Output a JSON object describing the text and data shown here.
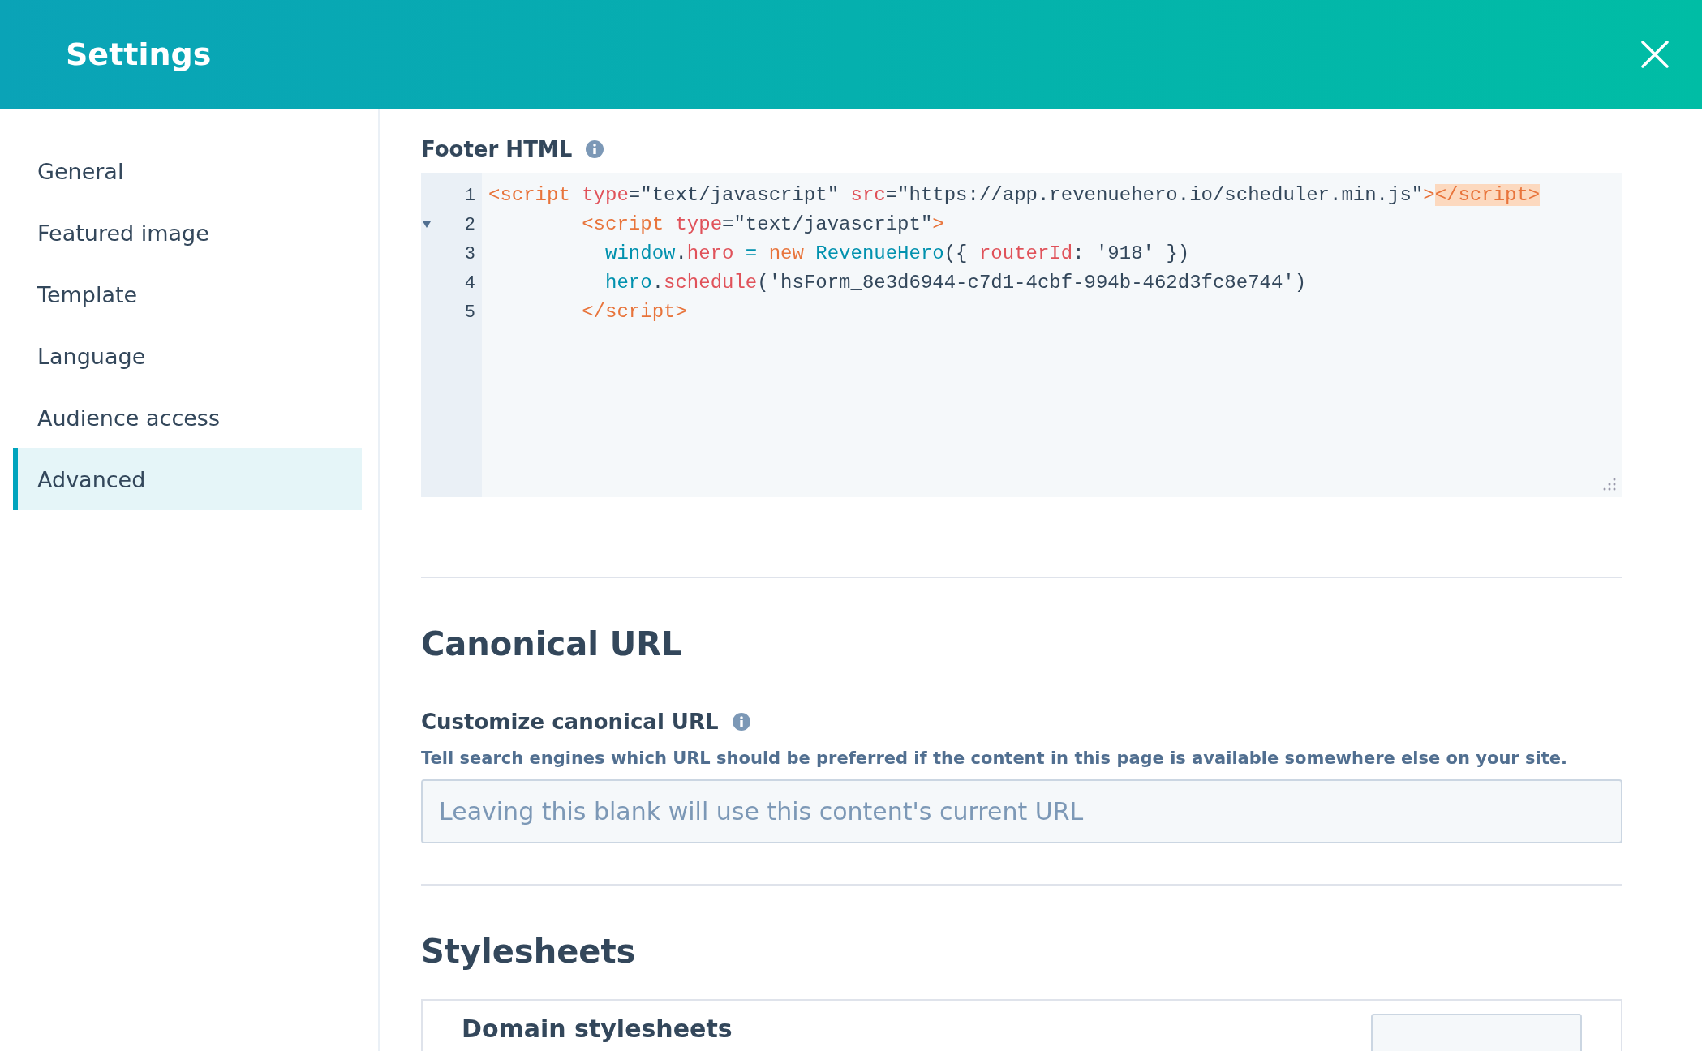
{
  "header": {
    "title": "Settings"
  },
  "sidebar": {
    "items": [
      {
        "label": "General",
        "selected": false
      },
      {
        "label": "Featured image",
        "selected": false
      },
      {
        "label": "Template",
        "selected": false
      },
      {
        "label": "Language",
        "selected": false
      },
      {
        "label": "Audience access",
        "selected": false
      },
      {
        "label": "Advanced",
        "selected": true
      }
    ]
  },
  "footer_html": {
    "label": "Footer HTML",
    "editor": {
      "lines": [
        {
          "number": "1",
          "fold": false,
          "tokens": [
            {
              "kind": "tag",
              "text": "<script "
            },
            {
              "kind": "attr",
              "text": "type"
            },
            {
              "kind": "plain",
              "text": "=\"text/javascript\" "
            },
            {
              "kind": "attr",
              "text": "src"
            },
            {
              "kind": "plain",
              "text": "=\"https://app.revenuehero.io/scheduler.min.js\""
            },
            {
              "kind": "tag",
              "text": ">"
            },
            {
              "kind": "match",
              "text": "</script>"
            }
          ]
        },
        {
          "number": "2",
          "fold": true,
          "tokens": [
            {
              "kind": "tag",
              "text": "        <script "
            },
            {
              "kind": "attr",
              "text": "type"
            },
            {
              "kind": "plain",
              "text": "=\"text/javascript\""
            },
            {
              "kind": "tag",
              "text": ">"
            }
          ]
        },
        {
          "number": "3",
          "fold": false,
          "tokens": [
            {
              "kind": "ident",
              "text": "          window"
            },
            {
              "kind": "plain",
              "text": "."
            },
            {
              "kind": "attr",
              "text": "hero "
            },
            {
              "kind": "ident",
              "text": "= "
            },
            {
              "kind": "tag",
              "text": "new "
            },
            {
              "kind": "ident",
              "text": "RevenueHero"
            },
            {
              "kind": "plain",
              "text": "({ "
            },
            {
              "kind": "attr",
              "text": "routerId"
            },
            {
              "kind": "plain",
              "text": ": '918' })"
            }
          ]
        },
        {
          "number": "4",
          "fold": false,
          "tokens": [
            {
              "kind": "ident",
              "text": "          hero"
            },
            {
              "kind": "plain",
              "text": "."
            },
            {
              "kind": "attr",
              "text": "schedule"
            },
            {
              "kind": "plain",
              "text": "('hsForm_8e3d6944-c7d1-4cbf-994b-462d3fc8e744')"
            }
          ]
        },
        {
          "number": "5",
          "fold": false,
          "tokens": [
            {
              "kind": "tag",
              "text": "        </script>"
            }
          ]
        }
      ]
    }
  },
  "canonical_url": {
    "heading": "Canonical URL",
    "field_label": "Customize canonical URL",
    "help": "Tell search engines which URL should be preferred if the content in this page is available somewhere else on your site.",
    "placeholder": "Leaving this blank will use this content's current URL"
  },
  "stylesheets": {
    "heading": "Stylesheets",
    "card_title": "Domain stylesheets"
  }
}
